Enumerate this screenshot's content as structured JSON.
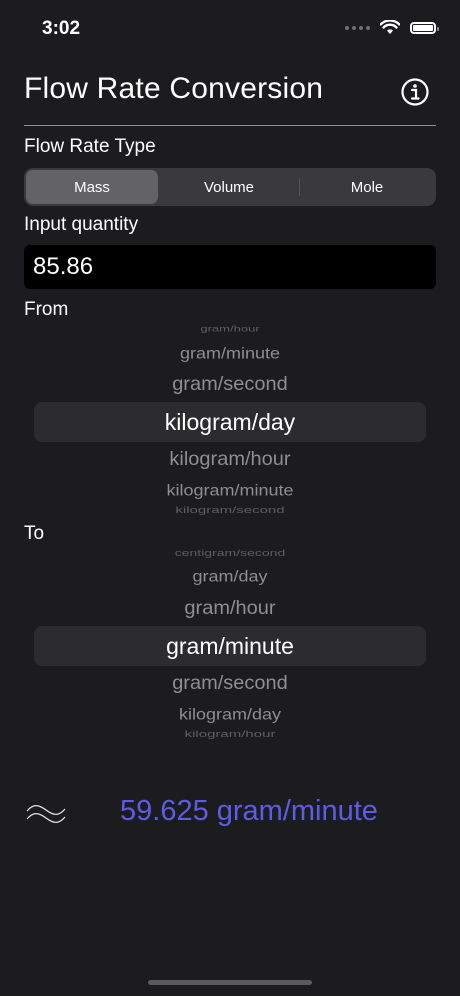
{
  "status": {
    "time": "3:02"
  },
  "header": {
    "title": "Flow Rate Conversion"
  },
  "flow_type": {
    "label": "Flow Rate Type",
    "options": [
      "Mass",
      "Volume",
      "Mole"
    ],
    "selected": "Mass"
  },
  "input": {
    "label": "Input quantity",
    "value": "85.86"
  },
  "from": {
    "label": "From",
    "items": [
      "gram/hour",
      "gram/minute",
      "gram/second",
      "kilogram/day",
      "kilogram/hour",
      "kilogram/minute",
      "kilogram/second"
    ],
    "selected": "kilogram/day"
  },
  "to": {
    "label": "To",
    "items": [
      "centigram/second",
      "gram/day",
      "gram/hour",
      "gram/minute",
      "gram/second",
      "kilogram/day",
      "kilogram/hour"
    ],
    "selected": "gram/minute"
  },
  "result": {
    "approx_symbol": "≈",
    "text": "59.625 gram/minute"
  },
  "colors": {
    "accent": "#5e5ce6",
    "background": "#1c1c1e"
  }
}
